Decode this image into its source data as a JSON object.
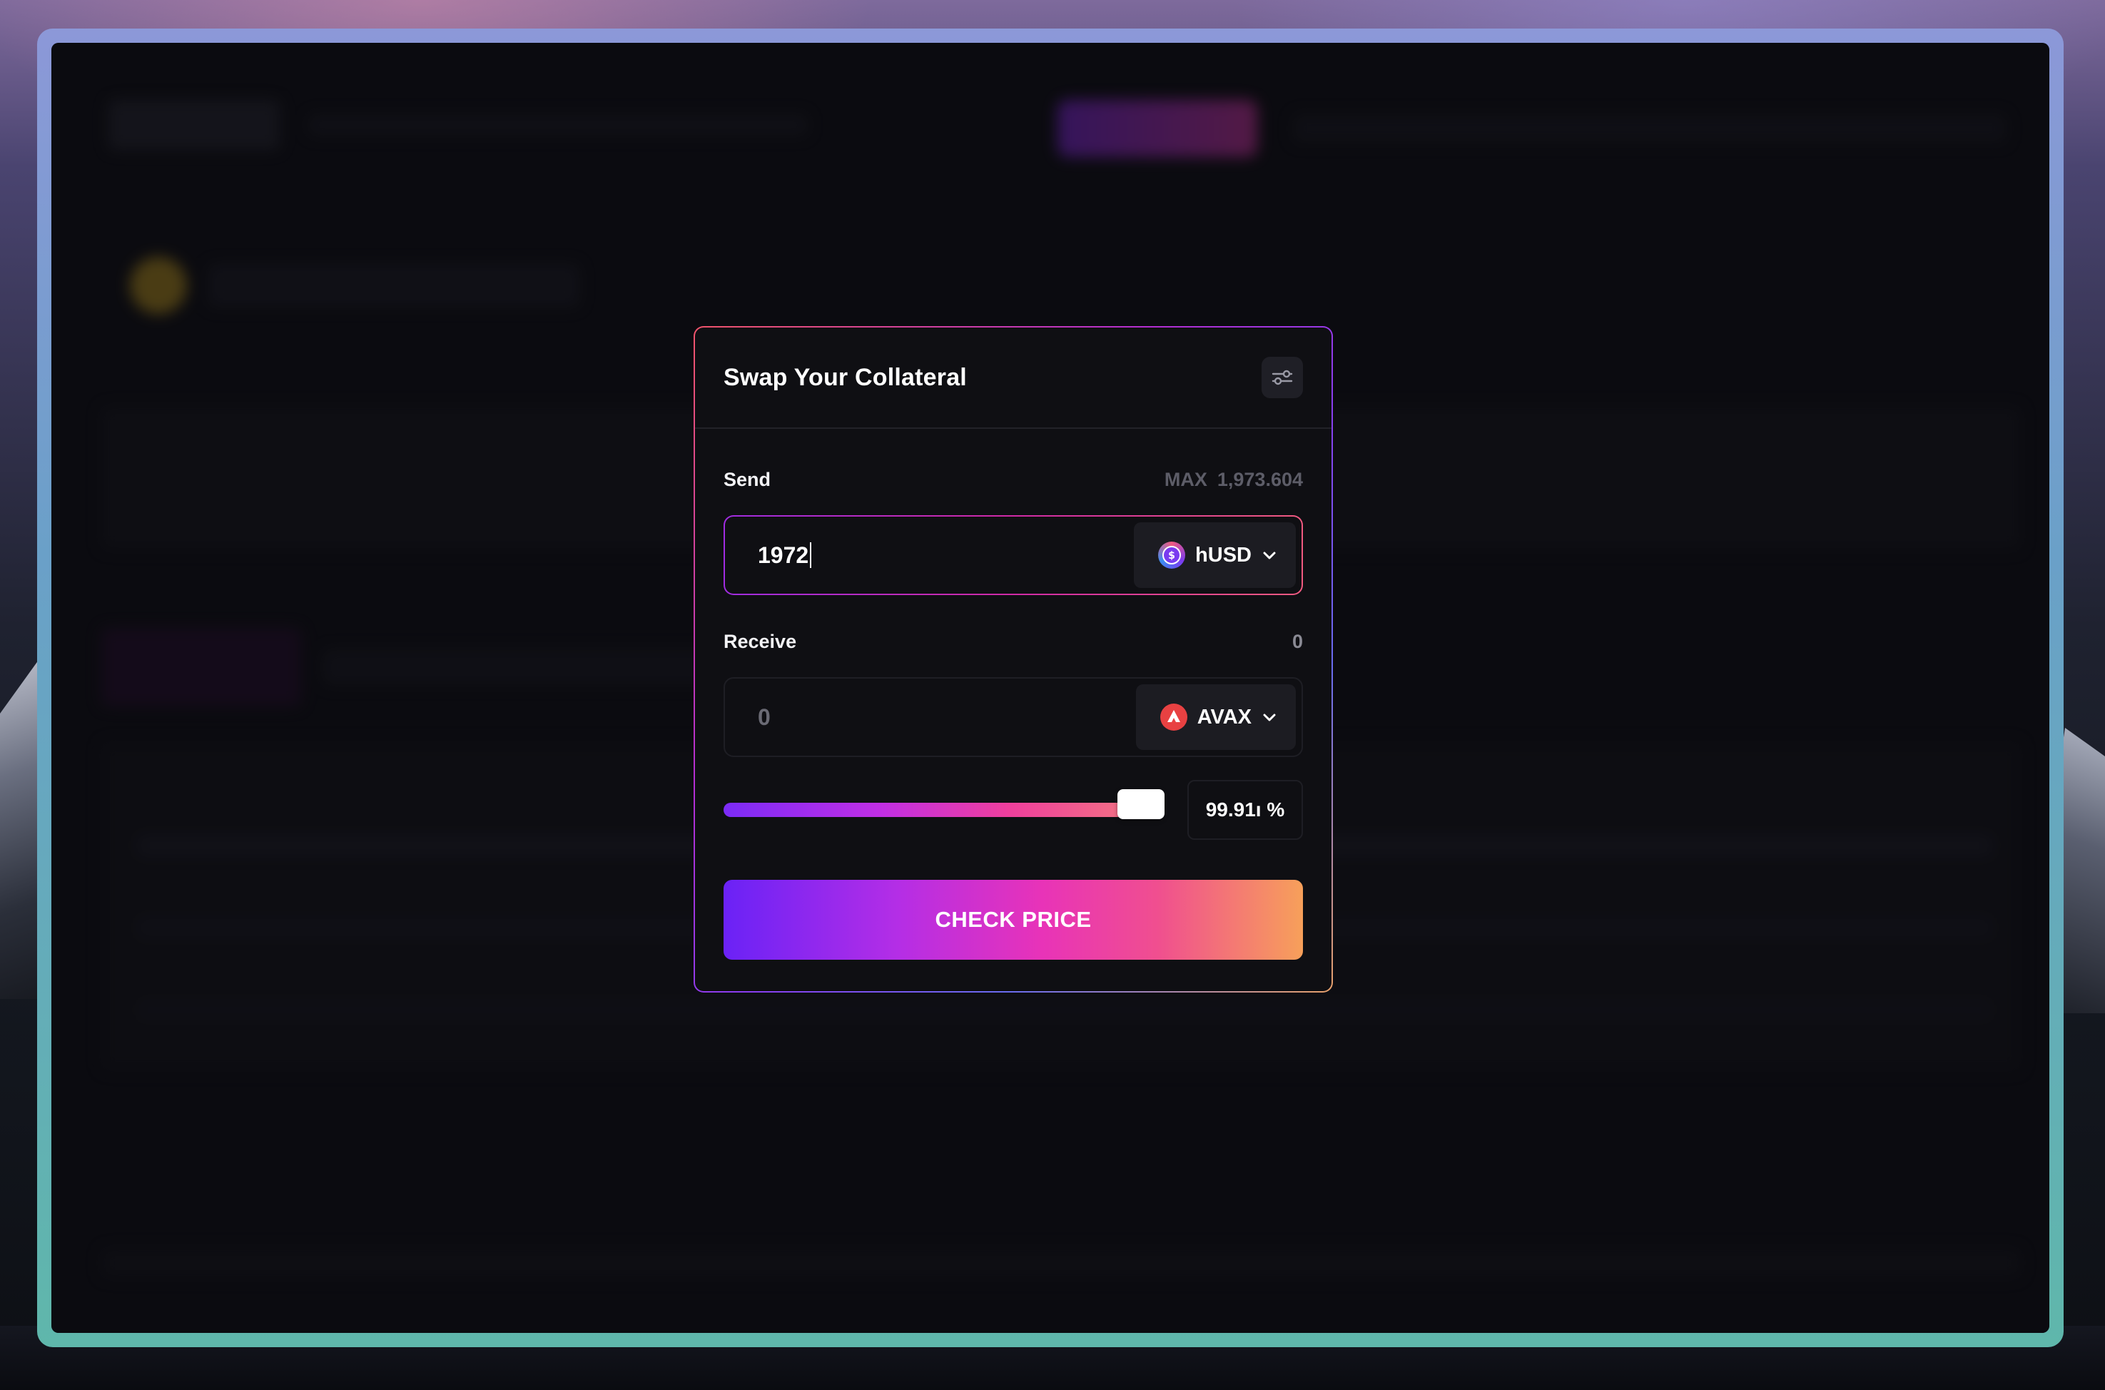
{
  "modal": {
    "title": "Swap Your Collateral",
    "settings_icon": "sliders-icon"
  },
  "send": {
    "label": "Send",
    "max_label": "MAX",
    "max_value": "1,973.604",
    "amount": "1972",
    "token": {
      "name": "hUSD",
      "icon": "husd-token-icon",
      "color": "#7a3bf0"
    }
  },
  "receive": {
    "label": "Receive",
    "value": "0",
    "amount": "0",
    "token": {
      "name": "AVAX",
      "icon": "avax-token-icon",
      "color": "#e84142"
    }
  },
  "slider": {
    "percent_text": "99.91ı %",
    "level_percent": 99.91
  },
  "action": {
    "label": "CHECK PRICE"
  },
  "colors": {
    "accent_start": "#6a22f6",
    "accent_mid": "#e833b8",
    "accent_end": "#f7a05a",
    "modal_bg": "#0f0f13"
  }
}
